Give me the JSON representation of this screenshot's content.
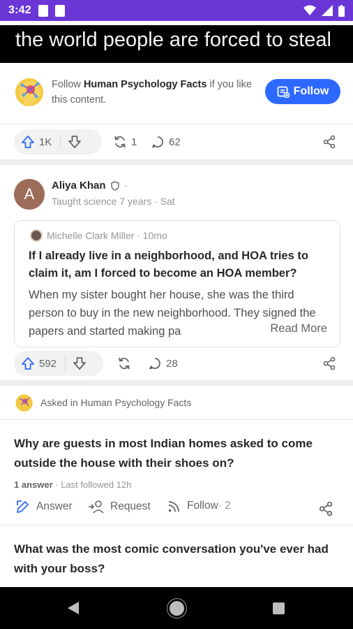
{
  "status_bar": {
    "time": "3:42"
  },
  "banner": {
    "caption": "the world people are forced to steal"
  },
  "follow_card": {
    "prefix": "Follow ",
    "space_name": "Human Psychology Facts",
    "suffix": " if you like this content.",
    "button_label": "Follow"
  },
  "post1_actions": {
    "upvotes": "1K",
    "shares": "1",
    "comments": "62"
  },
  "post2": {
    "author_name": "Aliya Khan",
    "avatar_letter": "A",
    "credential": "Taught science 7 years · Sat",
    "quoted": {
      "author": "Michelle Clark Miller · 10mo",
      "question": "If I already live in a neighborhood, and HOA tries to claim it, am I forced to become an HOA member?",
      "body": "When my sister bought her house, she was the third person to buy in the new neighborhood. They signed the papers and started making pa",
      "read_more": "Read More"
    },
    "actions": {
      "upvotes": "592",
      "comments": "28"
    }
  },
  "question_card": {
    "asked_in": "Asked in Human Psychology Facts",
    "title": "Why are guests in most Indian homes asked to come outside the house with their shoes on?",
    "answers": "1 answer",
    "last_followed": " · Last followed 12h",
    "answer_label": "Answer",
    "request_label": "Request",
    "follow_label": "Follow",
    "follow_count": " · 2"
  },
  "next_question": {
    "title": "What was the most comic conversation you've ever had with your boss?"
  },
  "colors": {
    "status_bar": "#6b36d6",
    "follow_button": "#2e69ff",
    "upvote": "#2e69ff"
  }
}
